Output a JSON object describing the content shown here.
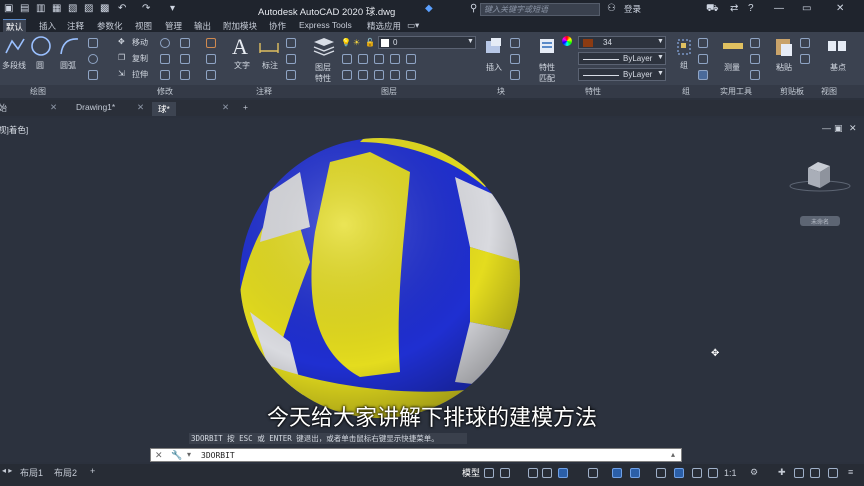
{
  "window": {
    "title": "Autodesk AutoCAD 2020    球.dwg"
  },
  "search": {
    "placeholder": "键入关键字或短语"
  },
  "user": {
    "label": "登录"
  },
  "ribbon_tabs": [
    "默认",
    "插入",
    "注释",
    "参数化",
    "视图",
    "管理",
    "输出",
    "附加模块",
    "协作",
    "Express Tools",
    "精选应用"
  ],
  "ribbon": {
    "draw": {
      "polyline": "多段线",
      "circle": "圆",
      "arc": "圆弧"
    },
    "modify": {
      "move": "移动",
      "copy": "复制",
      "stretch": "拉伸"
    },
    "annotation": {
      "text": "文字",
      "dim": "标注"
    },
    "layers": {
      "layer_props": "图层特性",
      "layer_value": "0"
    },
    "block": {
      "insert": "插入"
    },
    "properties": {
      "match": "特性匹配",
      "color_value": "34",
      "linetype": "ByLayer",
      "lineweight": "ByLayer"
    },
    "groups": {
      "group": "组"
    },
    "utilities": {
      "measure": "测量"
    },
    "clipboard": {
      "paste": "粘贴"
    },
    "view": {
      "base": "基点"
    },
    "panel_titles": {
      "draw": "绘图",
      "modify": "修改",
      "annotation": "注释",
      "layers": "图层",
      "block": "块",
      "properties": "特性",
      "groups": "组",
      "utilities": "实用工具",
      "clipboard": "剪贴板",
      "view": "视图"
    }
  },
  "doc_tabs": {
    "start": "开始",
    "drawing1": "Drawing1*",
    "sphere": "球*",
    "add": "+"
  },
  "viewport": {
    "label": "[-][自定义视图][真实][着色]",
    "short_label": "视]着色]",
    "viewcube_compass": "未命名"
  },
  "subtitle": "今天给大家讲解下排球的建模方法",
  "command": {
    "hint": "3DORBIT 按 ESC 或 ENTER 键退出，或者单击鼠标右键显示快捷菜单。",
    "input": "3DORBIT"
  },
  "status": {
    "layout_tabs": [
      "布局1",
      "布局2"
    ],
    "add": "+",
    "model": "模型",
    "scale": "1:1"
  },
  "colors": {
    "accent": "#5a8ac8",
    "ball_blue": "#1f2fd1",
    "ball_yellow": "#e4dc1e",
    "ball_white": "#d9dadf"
  }
}
